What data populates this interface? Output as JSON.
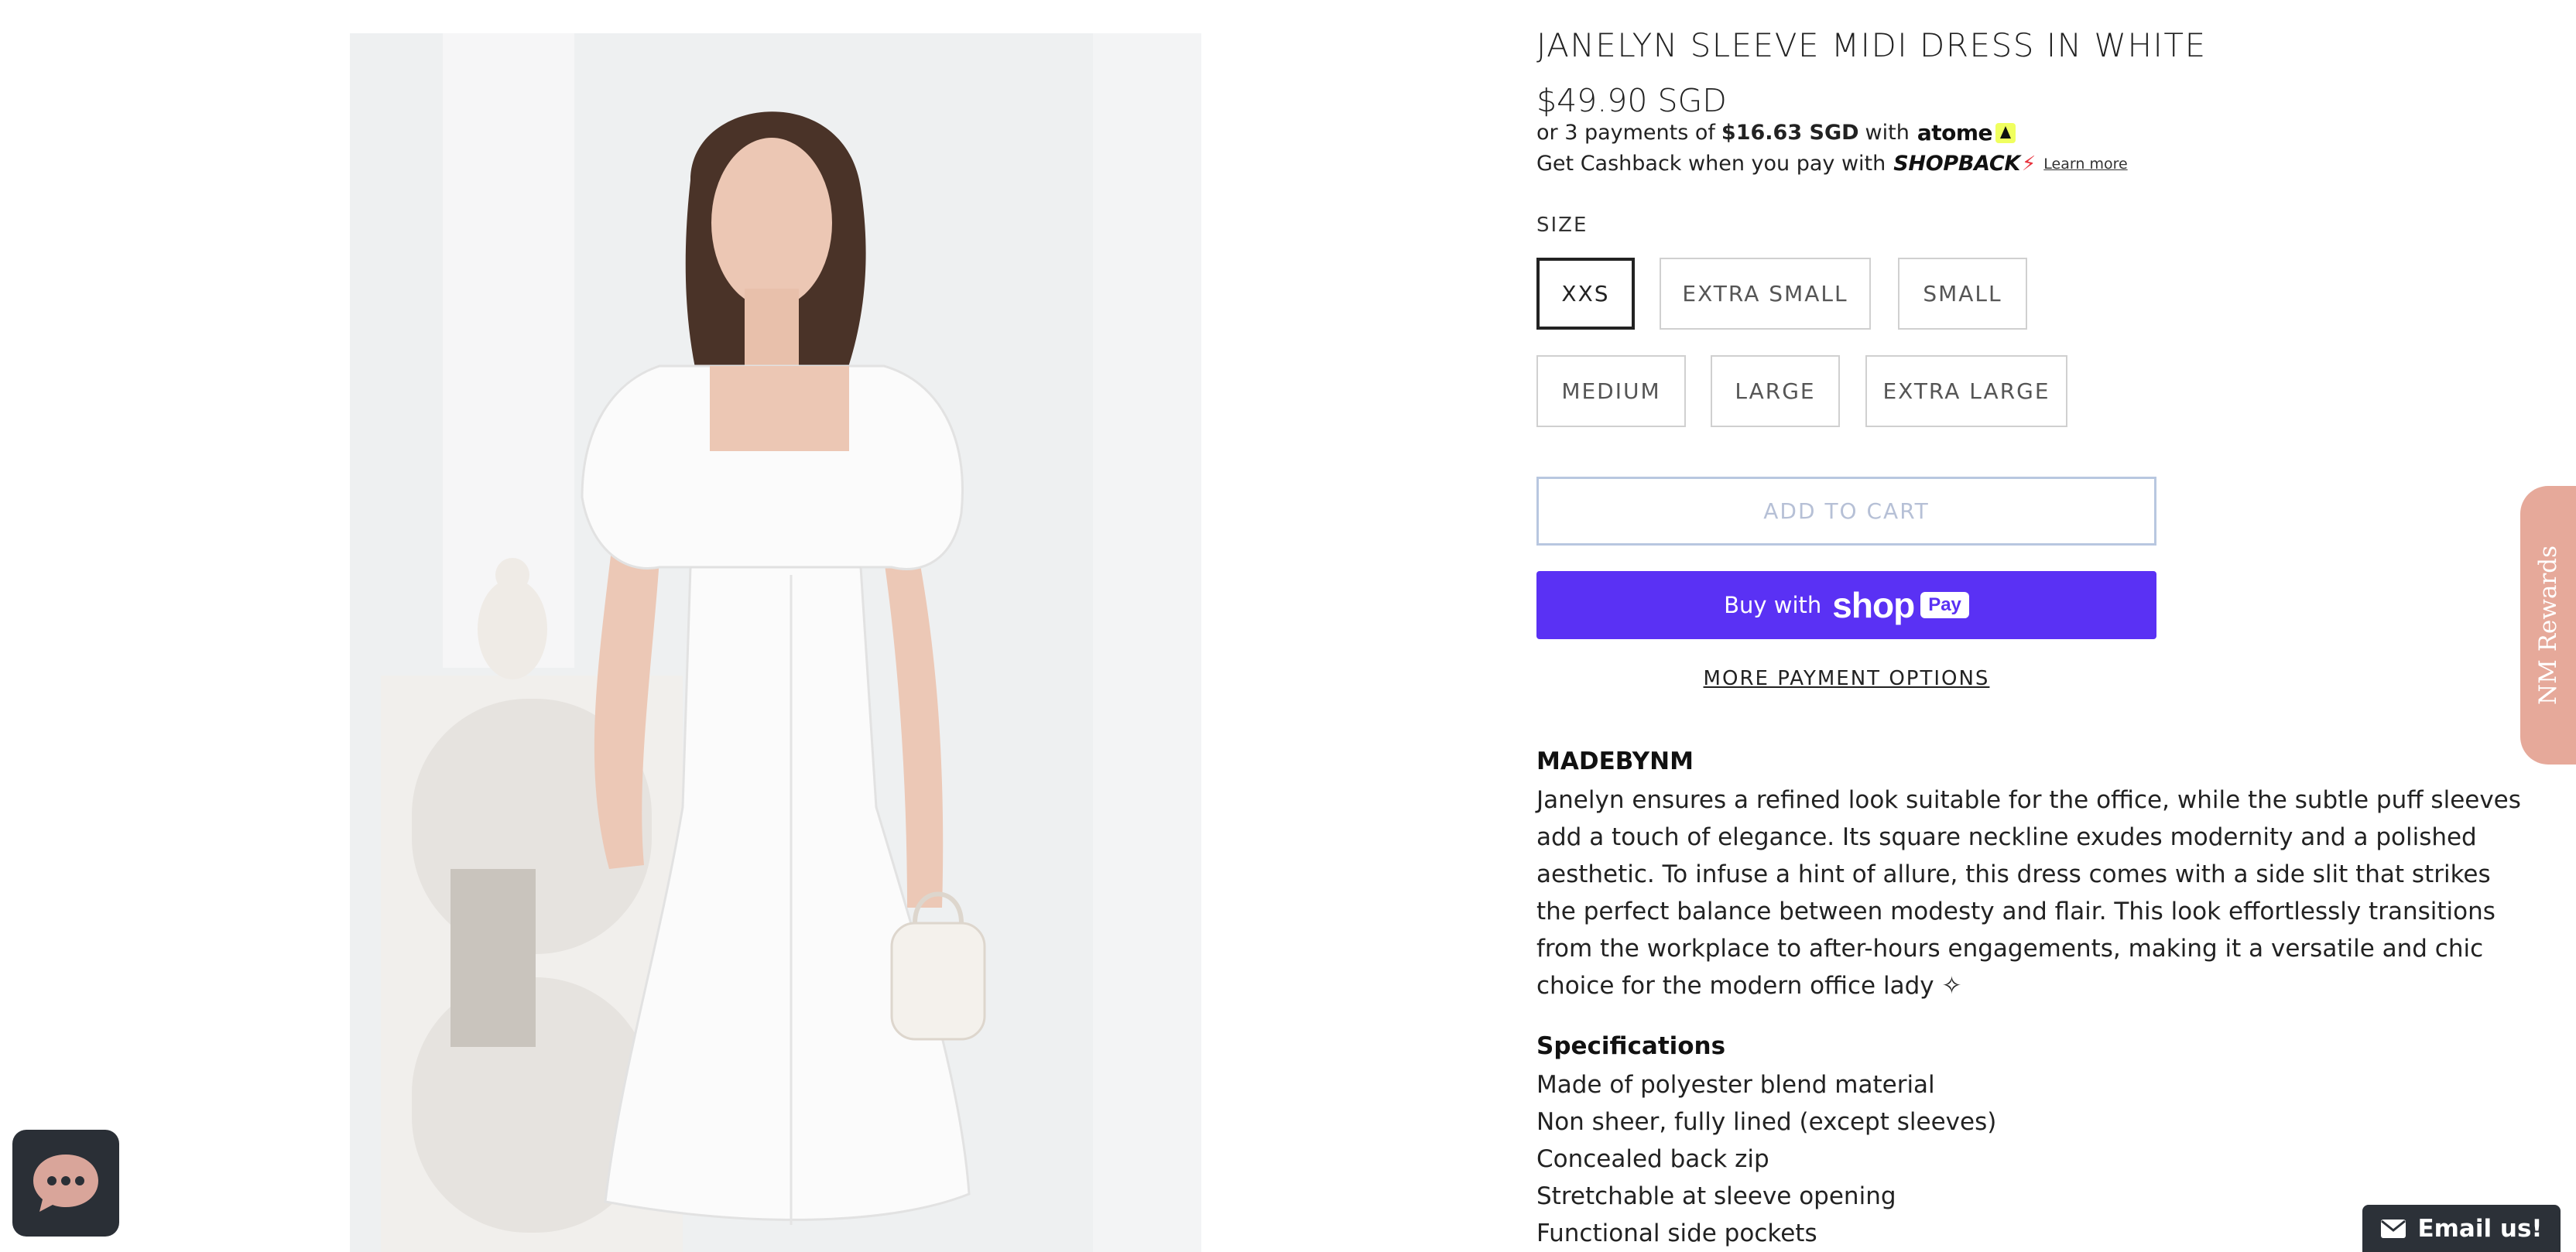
{
  "product": {
    "title": "JANELYN SLEEVE MIDI DRESS IN WHITE",
    "price": "$49.90 SGD"
  },
  "atome": {
    "prefix": "or 3 payments of",
    "amount": "$16.63 SGD",
    "with": "with",
    "brand": "atome"
  },
  "cashback": {
    "text": "Get Cashback when you pay with",
    "brand": "SHOPBACK",
    "learn_more": "Learn more"
  },
  "size": {
    "label": "SIZE",
    "options": [
      "XXS",
      "EXTRA SMALL",
      "SMALL",
      "MEDIUM",
      "LARGE",
      "EXTRA LARGE"
    ],
    "selected": "XXS"
  },
  "buttons": {
    "add_to_cart": "ADD TO CART",
    "buy_with": "Buy with",
    "shop_word": "shop",
    "pay_word": "Pay",
    "more_options": "MORE PAYMENT OPTIONS"
  },
  "description": {
    "brand": "MADEBYNM",
    "text": "Janelyn ensures a refined look suitable for the office, while the subtle puff sleeves add a touch of elegance. Its square neckline exudes modernity and a polished aesthetic. To infuse a hint of allure, this dress comes with a side slit that strikes the perfect balance between modesty and flair. This look effortlessly transitions from the workplace to after-hours engagements, making it a versatile and chic choice for the modern office lady ✧"
  },
  "specifications": {
    "title": "Specifications",
    "items": [
      "Made of polyester blend material",
      "Non sheer, fully lined (except sleeves)",
      "Concealed back zip",
      "Stretchable at sleeve opening",
      "Functional side pockets"
    ]
  },
  "widgets": {
    "rewards": "NM Rewards",
    "email_us": "Email us!"
  },
  "colors": {
    "shop_pay": "#5a31f4",
    "rewards_tab": "#e6a99a",
    "dark_widget": "#2c3138"
  }
}
